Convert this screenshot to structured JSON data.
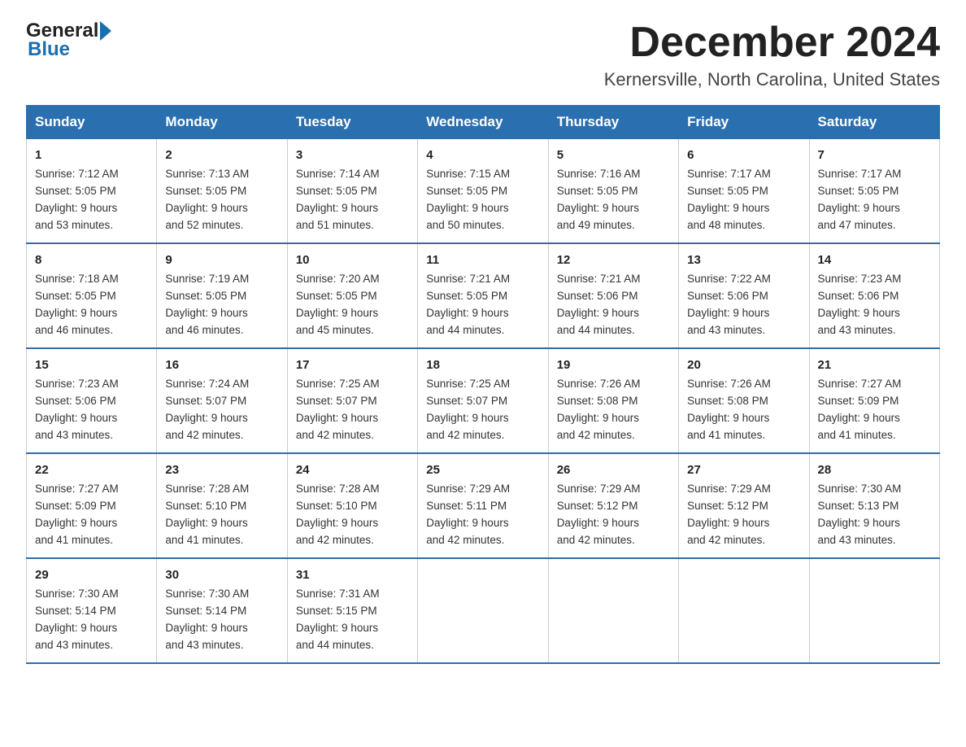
{
  "logo": {
    "general": "General",
    "blue": "Blue"
  },
  "header": {
    "title": "December 2024",
    "subtitle": "Kernersville, North Carolina, United States"
  },
  "columns": [
    "Sunday",
    "Monday",
    "Tuesday",
    "Wednesday",
    "Thursday",
    "Friday",
    "Saturday"
  ],
  "weeks": [
    [
      {
        "day": "1",
        "sunrise": "Sunrise: 7:12 AM",
        "sunset": "Sunset: 5:05 PM",
        "daylight": "Daylight: 9 hours",
        "minutes": "and 53 minutes."
      },
      {
        "day": "2",
        "sunrise": "Sunrise: 7:13 AM",
        "sunset": "Sunset: 5:05 PM",
        "daylight": "Daylight: 9 hours",
        "minutes": "and 52 minutes."
      },
      {
        "day": "3",
        "sunrise": "Sunrise: 7:14 AM",
        "sunset": "Sunset: 5:05 PM",
        "daylight": "Daylight: 9 hours",
        "minutes": "and 51 minutes."
      },
      {
        "day": "4",
        "sunrise": "Sunrise: 7:15 AM",
        "sunset": "Sunset: 5:05 PM",
        "daylight": "Daylight: 9 hours",
        "minutes": "and 50 minutes."
      },
      {
        "day": "5",
        "sunrise": "Sunrise: 7:16 AM",
        "sunset": "Sunset: 5:05 PM",
        "daylight": "Daylight: 9 hours",
        "minutes": "and 49 minutes."
      },
      {
        "day": "6",
        "sunrise": "Sunrise: 7:17 AM",
        "sunset": "Sunset: 5:05 PM",
        "daylight": "Daylight: 9 hours",
        "minutes": "and 48 minutes."
      },
      {
        "day": "7",
        "sunrise": "Sunrise: 7:17 AM",
        "sunset": "Sunset: 5:05 PM",
        "daylight": "Daylight: 9 hours",
        "minutes": "and 47 minutes."
      }
    ],
    [
      {
        "day": "8",
        "sunrise": "Sunrise: 7:18 AM",
        "sunset": "Sunset: 5:05 PM",
        "daylight": "Daylight: 9 hours",
        "minutes": "and 46 minutes."
      },
      {
        "day": "9",
        "sunrise": "Sunrise: 7:19 AM",
        "sunset": "Sunset: 5:05 PM",
        "daylight": "Daylight: 9 hours",
        "minutes": "and 46 minutes."
      },
      {
        "day": "10",
        "sunrise": "Sunrise: 7:20 AM",
        "sunset": "Sunset: 5:05 PM",
        "daylight": "Daylight: 9 hours",
        "minutes": "and 45 minutes."
      },
      {
        "day": "11",
        "sunrise": "Sunrise: 7:21 AM",
        "sunset": "Sunset: 5:05 PM",
        "daylight": "Daylight: 9 hours",
        "minutes": "and 44 minutes."
      },
      {
        "day": "12",
        "sunrise": "Sunrise: 7:21 AM",
        "sunset": "Sunset: 5:06 PM",
        "daylight": "Daylight: 9 hours",
        "minutes": "and 44 minutes."
      },
      {
        "day": "13",
        "sunrise": "Sunrise: 7:22 AM",
        "sunset": "Sunset: 5:06 PM",
        "daylight": "Daylight: 9 hours",
        "minutes": "and 43 minutes."
      },
      {
        "day": "14",
        "sunrise": "Sunrise: 7:23 AM",
        "sunset": "Sunset: 5:06 PM",
        "daylight": "Daylight: 9 hours",
        "minutes": "and 43 minutes."
      }
    ],
    [
      {
        "day": "15",
        "sunrise": "Sunrise: 7:23 AM",
        "sunset": "Sunset: 5:06 PM",
        "daylight": "Daylight: 9 hours",
        "minutes": "and 43 minutes."
      },
      {
        "day": "16",
        "sunrise": "Sunrise: 7:24 AM",
        "sunset": "Sunset: 5:07 PM",
        "daylight": "Daylight: 9 hours",
        "minutes": "and 42 minutes."
      },
      {
        "day": "17",
        "sunrise": "Sunrise: 7:25 AM",
        "sunset": "Sunset: 5:07 PM",
        "daylight": "Daylight: 9 hours",
        "minutes": "and 42 minutes."
      },
      {
        "day": "18",
        "sunrise": "Sunrise: 7:25 AM",
        "sunset": "Sunset: 5:07 PM",
        "daylight": "Daylight: 9 hours",
        "minutes": "and 42 minutes."
      },
      {
        "day": "19",
        "sunrise": "Sunrise: 7:26 AM",
        "sunset": "Sunset: 5:08 PM",
        "daylight": "Daylight: 9 hours",
        "minutes": "and 42 minutes."
      },
      {
        "day": "20",
        "sunrise": "Sunrise: 7:26 AM",
        "sunset": "Sunset: 5:08 PM",
        "daylight": "Daylight: 9 hours",
        "minutes": "and 41 minutes."
      },
      {
        "day": "21",
        "sunrise": "Sunrise: 7:27 AM",
        "sunset": "Sunset: 5:09 PM",
        "daylight": "Daylight: 9 hours",
        "minutes": "and 41 minutes."
      }
    ],
    [
      {
        "day": "22",
        "sunrise": "Sunrise: 7:27 AM",
        "sunset": "Sunset: 5:09 PM",
        "daylight": "Daylight: 9 hours",
        "minutes": "and 41 minutes."
      },
      {
        "day": "23",
        "sunrise": "Sunrise: 7:28 AM",
        "sunset": "Sunset: 5:10 PM",
        "daylight": "Daylight: 9 hours",
        "minutes": "and 41 minutes."
      },
      {
        "day": "24",
        "sunrise": "Sunrise: 7:28 AM",
        "sunset": "Sunset: 5:10 PM",
        "daylight": "Daylight: 9 hours",
        "minutes": "and 42 minutes."
      },
      {
        "day": "25",
        "sunrise": "Sunrise: 7:29 AM",
        "sunset": "Sunset: 5:11 PM",
        "daylight": "Daylight: 9 hours",
        "minutes": "and 42 minutes."
      },
      {
        "day": "26",
        "sunrise": "Sunrise: 7:29 AM",
        "sunset": "Sunset: 5:12 PM",
        "daylight": "Daylight: 9 hours",
        "minutes": "and 42 minutes."
      },
      {
        "day": "27",
        "sunrise": "Sunrise: 7:29 AM",
        "sunset": "Sunset: 5:12 PM",
        "daylight": "Daylight: 9 hours",
        "minutes": "and 42 minutes."
      },
      {
        "day": "28",
        "sunrise": "Sunrise: 7:30 AM",
        "sunset": "Sunset: 5:13 PM",
        "daylight": "Daylight: 9 hours",
        "minutes": "and 43 minutes."
      }
    ],
    [
      {
        "day": "29",
        "sunrise": "Sunrise: 7:30 AM",
        "sunset": "Sunset: 5:14 PM",
        "daylight": "Daylight: 9 hours",
        "minutes": "and 43 minutes."
      },
      {
        "day": "30",
        "sunrise": "Sunrise: 7:30 AM",
        "sunset": "Sunset: 5:14 PM",
        "daylight": "Daylight: 9 hours",
        "minutes": "and 43 minutes."
      },
      {
        "day": "31",
        "sunrise": "Sunrise: 7:31 AM",
        "sunset": "Sunset: 5:15 PM",
        "daylight": "Daylight: 9 hours",
        "minutes": "and 44 minutes."
      },
      null,
      null,
      null,
      null
    ]
  ]
}
